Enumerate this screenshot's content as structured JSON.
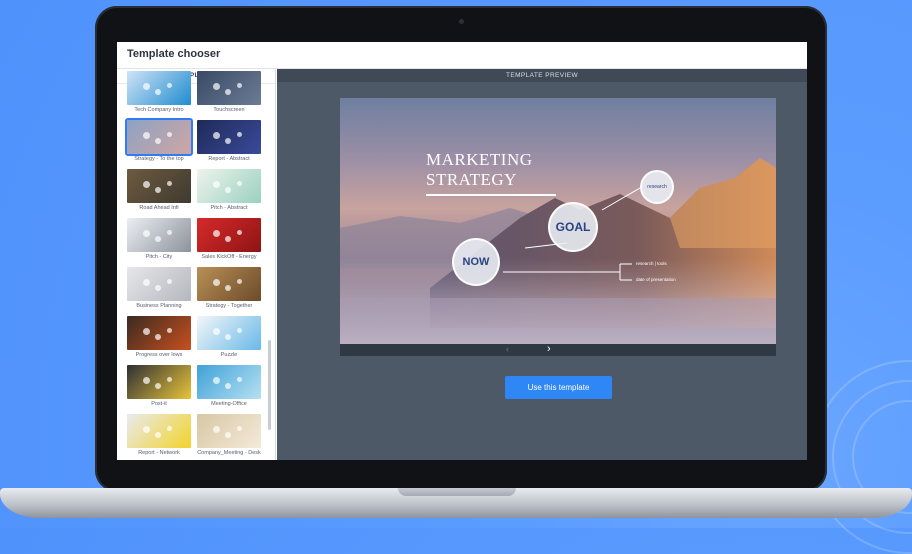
{
  "window": {
    "title": "Template chooser"
  },
  "sidebar": {
    "header": "TEMPLATES",
    "templates": [
      {
        "label": "Tech Company Intro",
        "colors": [
          "#cfe3f7",
          "#1f8ccf"
        ]
      },
      {
        "label": "Touchscreen",
        "colors": [
          "#384a66",
          "#6d7b95"
        ]
      },
      {
        "label": "Strategy - To the top",
        "colors": [
          "#8da2c4",
          "#cfa6a3"
        ]
      },
      {
        "label": "Report - Abstract",
        "colors": [
          "#1f2a58",
          "#3a4a9a"
        ]
      },
      {
        "label": "Road Ahead Infi",
        "colors": [
          "#6e5a40",
          "#3f3a30"
        ]
      },
      {
        "label": "Pitch - Abstract",
        "colors": [
          "#eef3ef",
          "#9ad1bf"
        ]
      },
      {
        "label": "Pitch - City",
        "colors": [
          "#eceff3",
          "#8c929c"
        ]
      },
      {
        "label": "Sales KickOff - Energy",
        "colors": [
          "#d62a2a",
          "#8f1414"
        ]
      },
      {
        "label": "Business Planning",
        "colors": [
          "#e6e7ea",
          "#b4b7bd"
        ]
      },
      {
        "label": "Strategy - Together",
        "colors": [
          "#b89056",
          "#6d4a2a"
        ]
      },
      {
        "label": "Progress over lows",
        "colors": [
          "#3b2a22",
          "#c8501e"
        ]
      },
      {
        "label": "Puzzle",
        "colors": [
          "#f4f6f8",
          "#69b9e8"
        ]
      },
      {
        "label": "Post-it",
        "colors": [
          "#2f2f33",
          "#e8c43a"
        ]
      },
      {
        "label": "Meeting-Office",
        "colors": [
          "#3fa2d8",
          "#b7e0f2"
        ]
      },
      {
        "label": "Report - Network",
        "colors": [
          "#e9eaee",
          "#f2d32a"
        ]
      },
      {
        "label": "Company_Meeting - Desk",
        "colors": [
          "#d8c7a6",
          "#f3ead8"
        ]
      }
    ]
  },
  "preview": {
    "header": "TEMPLATE PREVIEW",
    "slide": {
      "title_line1": "MARKETING",
      "title_line2": "STRATEGY",
      "now_label": "NOW",
      "goal_label": "GOAL",
      "small_bubble_label": "research",
      "branch_text_1": "research | tools",
      "branch_text_2": "date of presentation"
    },
    "use_button": "Use this template"
  }
}
